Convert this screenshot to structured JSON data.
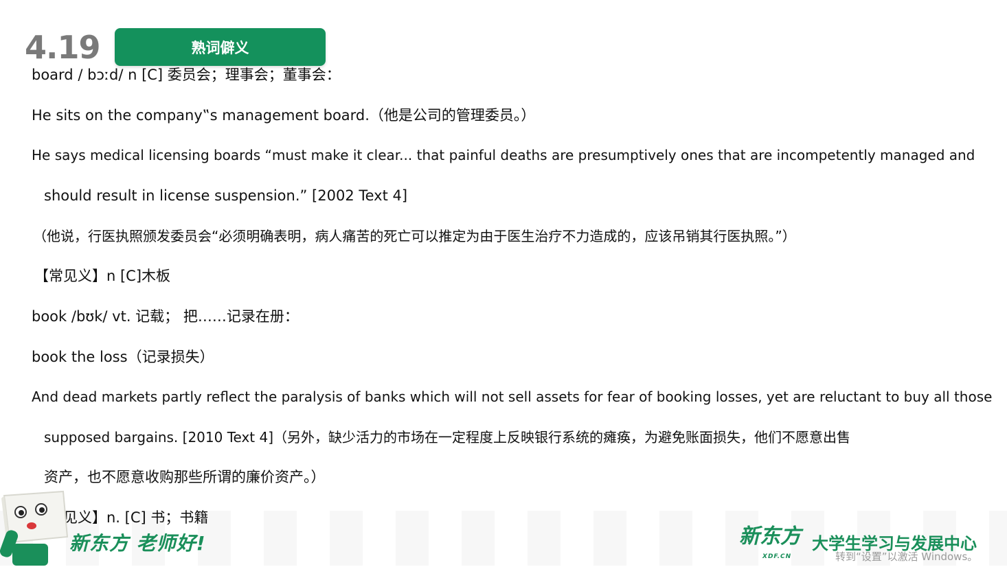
{
  "header": {
    "date": "4.19",
    "title": "熟词僻义"
  },
  "lines": [
    "board / bɔːd/ n [C] 委员会；理事会；董事会：",
    "He sits on the company‟s management board.（他是公司的管理委员。）",
    "He says medical licensing boards “must make it clear... that painful deaths are presumptively ones that are incompetently managed and",
    "should result in license suspension.” [2002 Text 4]",
    "（他说，行医执照颁发委员会“必须明确表明，病人痛苦的死亡可以推定为由于医生治疗不力造成的，应该吊销其行医执照。”）",
    "【常见义】n [C]木板",
    "book /bʊk/ vt. 记载； 把……记录在册：",
    "book the loss（记录损失）",
    "And dead markets partly reflect the paralysis of banks which will not sell assets for fear of booking losses, yet are reluctant to buy all those",
    "supposed bargains. [2010 Text 4]（另外，缺少活力的市场在一定程度上反映银行系统的瘫痪，为避免账面损失，他们不愿意出售",
    "资产，也不愿意收购那些所谓的廉价资产。）",
    "【常见义】n. [C] 书；书籍"
  ],
  "footer": {
    "greeting": "新东方 老师好!",
    "logo_text": "新东方",
    "logo_sub": "XDF.CN",
    "center_name": "大学生学习与发展中心",
    "activation_watermark": "转到“设置”以激活 Windows。"
  },
  "colors": {
    "brand_green": "#14915c",
    "date_gray": "#7a7a7a"
  }
}
